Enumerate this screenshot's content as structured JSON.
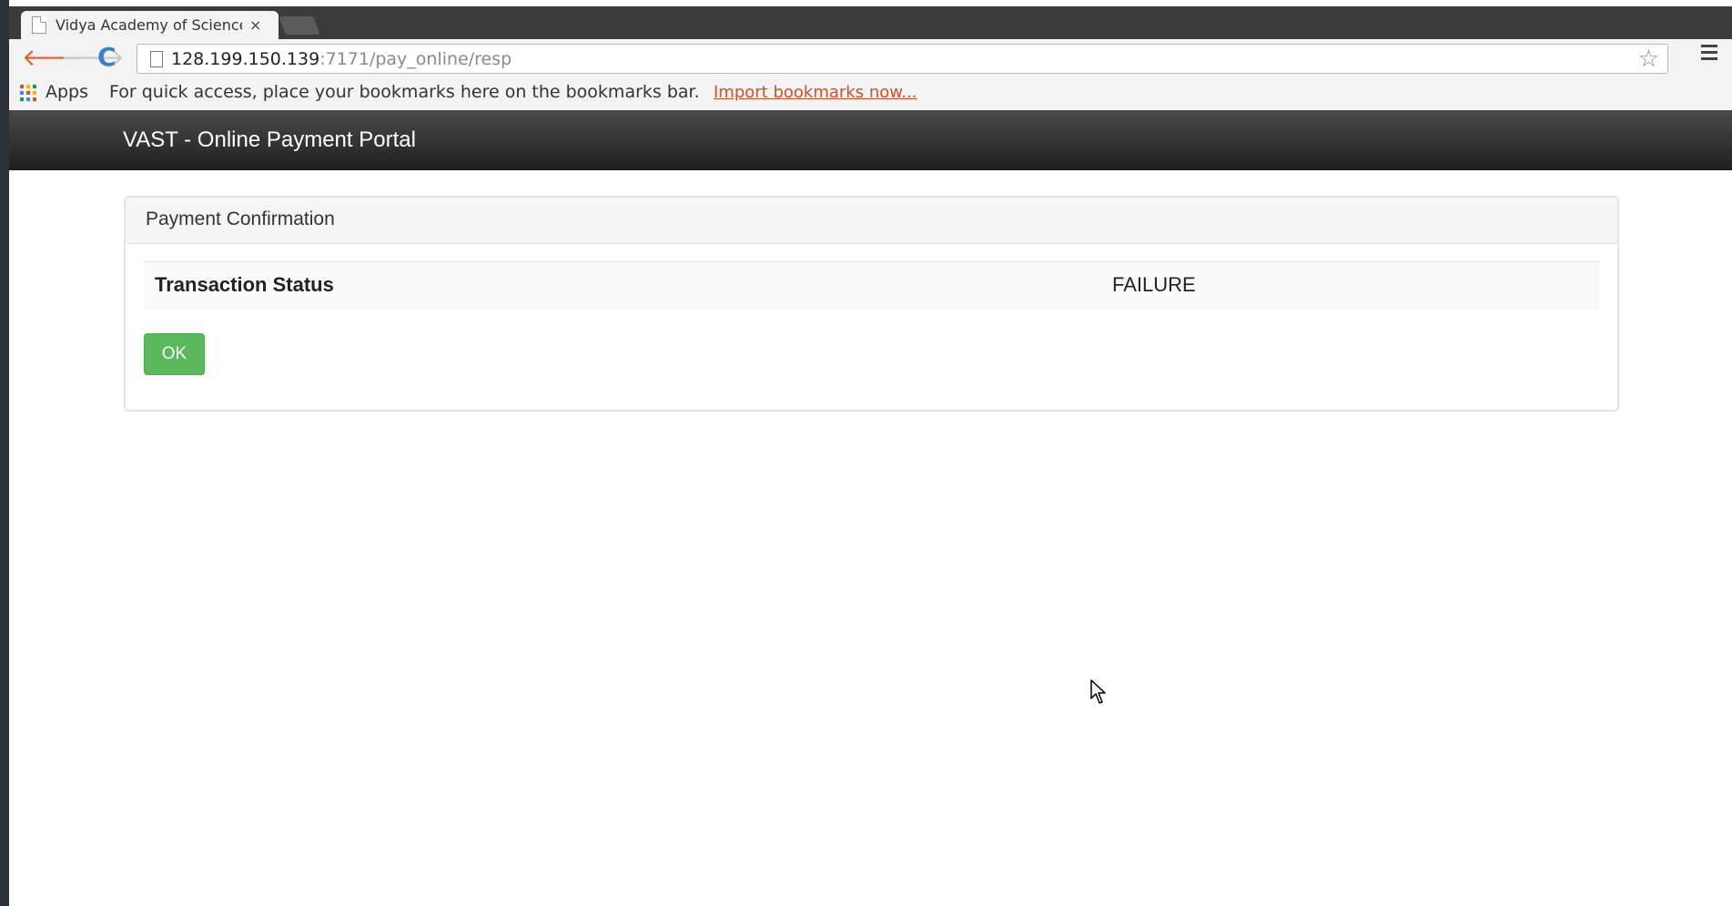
{
  "browser": {
    "tab_title": "Vidya Academy of Science",
    "tab_close": "×",
    "url_host": "128.199.150.139",
    "url_rest": ":7171/pay_online/resp",
    "star_icon": "☆",
    "back_icon": "🡐",
    "forward_icon": "🡒",
    "reload_icon": "C"
  },
  "bookmarks_bar": {
    "apps_label": "Apps",
    "hint": "For quick access, place your bookmarks here on the bookmarks bar.",
    "import_link": "Import bookmarks now..."
  },
  "navbar": {
    "brand": "VAST - Online Payment Portal"
  },
  "panel": {
    "heading": "Payment Confirmation",
    "rows": [
      {
        "label": "Transaction Status",
        "value": "FAILURE"
      }
    ],
    "ok_label": "OK"
  },
  "colors": {
    "accent_success": "#5cb85c",
    "navbar_dark": "#1f1f1f",
    "link_orange": "#d24f2b"
  }
}
